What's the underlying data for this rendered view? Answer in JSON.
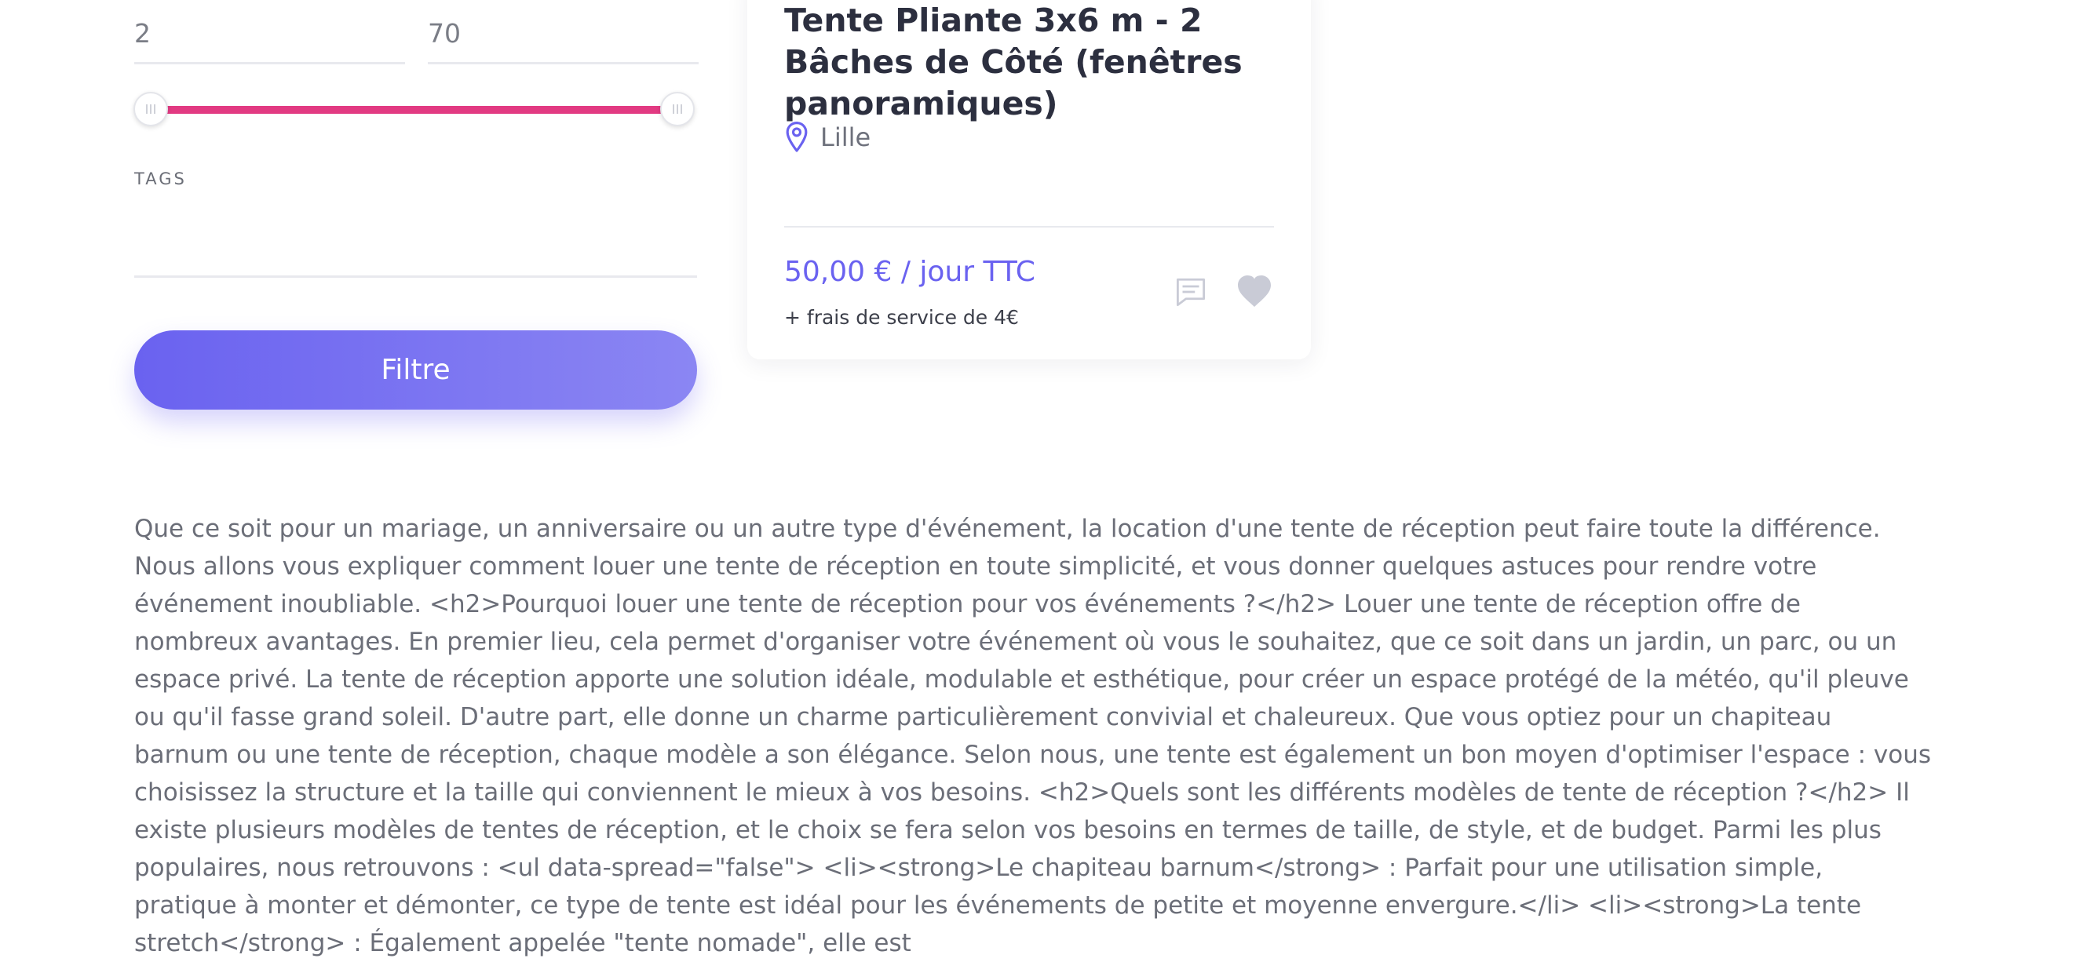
{
  "filter": {
    "price_min": "2",
    "price_max": "70",
    "tags_label": "TAGS",
    "tags_value": "",
    "button_label": "Filtre",
    "slider_color": "#e23a82",
    "button_color": "#6a62f0"
  },
  "card": {
    "title": "Tente Pliante 3x6 m - 2 Bâches de Côté (fenêtres panoramiques)",
    "location": "Lille",
    "location_icon": "map-pin-icon",
    "price": "50,00 € / jour TTC",
    "fee": "+ frais de service de 4€",
    "comment_icon": "comment-icon",
    "favorite_icon": "heart-icon",
    "accent_color": "#6a62f0"
  },
  "description": "Que ce soit pour un mariage, un anniversaire ou un autre type d'événement, la location d'une tente de réception peut faire toute la différence. Nous allons vous expliquer comment louer une tente de réception en toute simplicité, et vous donner quelques astuces pour rendre votre événement inoubliable. <h2>Pourquoi louer une tente de réception pour vos événements ?</h2> Louer une tente de réception offre de nombreux avantages. En premier lieu, cela permet d'organiser votre événement où vous le souhaitez, que ce soit dans un jardin, un parc, ou un espace privé. La tente de réception apporte une solution idéale, modulable et esthétique, pour créer un espace protégé de la météo, qu'il pleuve ou qu'il fasse grand soleil. D'autre part, elle donne un charme particulièrement convivial et chaleureux. Que vous optiez pour un chapiteau barnum ou une tente de réception, chaque modèle a son élégance. Selon nous, une tente est également un bon moyen d'optimiser l'espace : vous choisissez la structure et la taille qui conviennent le mieux à vos besoins. <h2>Quels sont les différents modèles de tente de réception ?</h2> Il existe plusieurs modèles de tentes de réception, et le choix se fera selon vos besoins en termes de taille, de style, et de budget. Parmi les plus populaires, nous retrouvons : <ul data-spread=\"false\"> <li><strong>Le chapiteau barnum</strong> : Parfait pour une utilisation simple, pratique à monter et démonter, ce type de tente est idéal pour les événements de petite et moyenne envergure.</li> <li><strong>La tente stretch</strong> : Également appelée \"tente nomade\", elle est"
}
